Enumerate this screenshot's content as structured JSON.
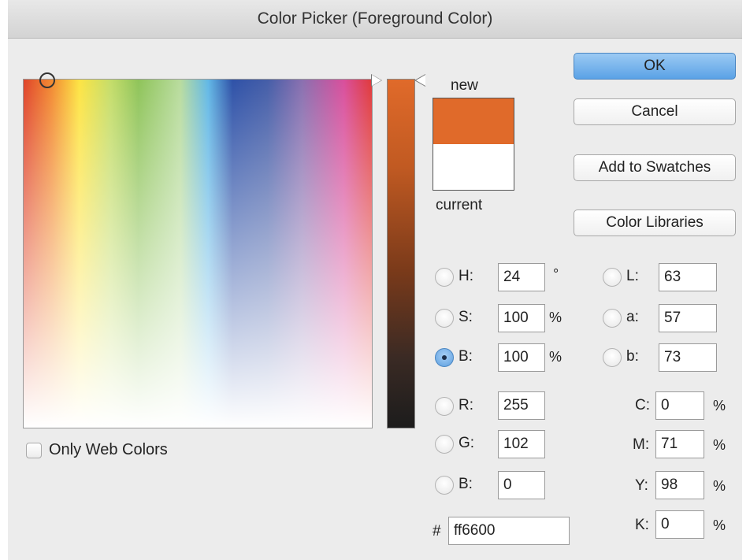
{
  "window": {
    "title": "Color Picker (Foreground Color)"
  },
  "swatches": {
    "new_label": "new",
    "current_label": "current",
    "new_color": "#e06a2a",
    "current_color": "#ffffff"
  },
  "buttons": {
    "ok": "OK",
    "cancel": "Cancel",
    "add_to_swatches": "Add to Swatches",
    "color_libraries": "Color Libraries"
  },
  "hsb": {
    "h": {
      "label": "H:",
      "value": "24",
      "unit": "°"
    },
    "s": {
      "label": "S:",
      "value": "100",
      "unit": "%"
    },
    "b": {
      "label": "B:",
      "value": "100",
      "unit": "%"
    }
  },
  "rgb": {
    "r": {
      "label": "R:",
      "value": "255"
    },
    "g": {
      "label": "G:",
      "value": "102"
    },
    "b": {
      "label": "B:",
      "value": "0"
    }
  },
  "lab": {
    "l": {
      "label": "L:",
      "value": "63"
    },
    "a": {
      "label": "a:",
      "value": "57"
    },
    "b": {
      "label": "b:",
      "value": "73"
    }
  },
  "cmyk": {
    "c": {
      "label": "C:",
      "value": "0",
      "unit": "%"
    },
    "m": {
      "label": "M:",
      "value": "71",
      "unit": "%"
    },
    "y": {
      "label": "Y:",
      "value": "98",
      "unit": "%"
    },
    "k": {
      "label": "K:",
      "value": "0",
      "unit": "%"
    }
  },
  "hex": {
    "label": "#",
    "value": "ff6600"
  },
  "only_web_colors": {
    "label": "Only Web Colors",
    "checked": false
  },
  "selected_mode": "B"
}
